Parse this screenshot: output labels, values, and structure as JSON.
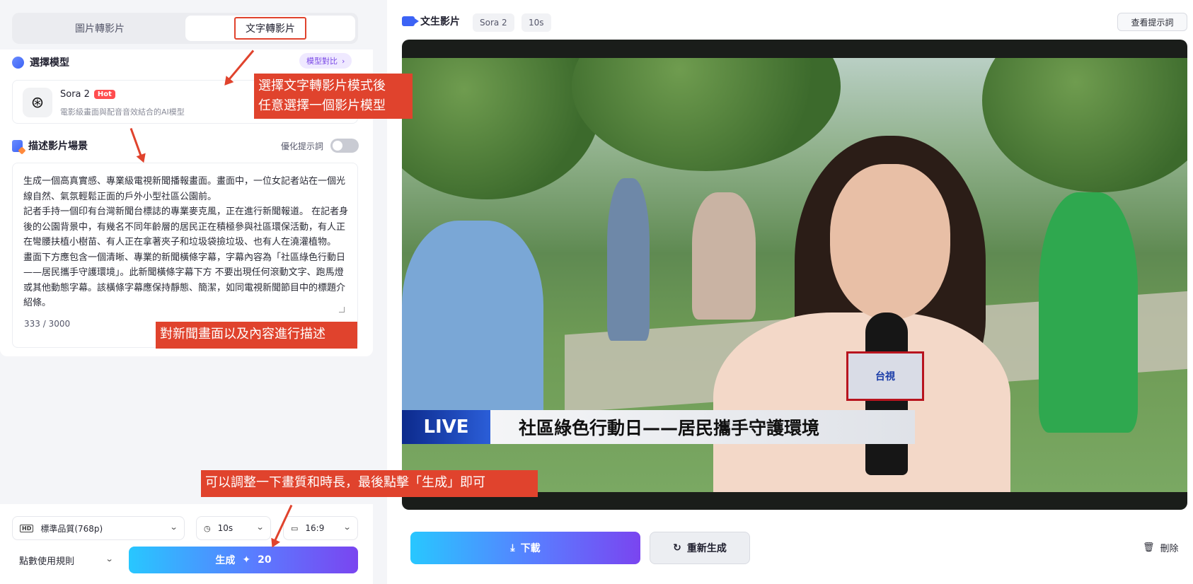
{
  "left_panel": {
    "mode_tabs": [
      "圖片轉影片",
      "文字轉影片"
    ],
    "model_section": {
      "title": "選擇模型",
      "compare_label": "模型對比",
      "model_name": "Sora 2",
      "hot_badge": "Hot",
      "model_desc": "電影級畫面與配音音效結合的AI模型"
    },
    "desc_section": {
      "title": "描述影片場景",
      "optimize_label": "優化提示詞",
      "prompt": "生成一個高真實感、專業級電視新聞播報畫面。畫面中，一位女記者站在一個光線自然、氣氛輕鬆正面的戶外小型社區公園前。\n記者手持一個印有台灣新聞台標誌的專業麥克風，正在進行新聞報道。 在記者身後的公園背景中，有幾名不同年齡層的居民正在積極參與社區環保活動，有人正在彎腰扶植小樹苗、有人正在拿著夾子和垃圾袋撿垃圾、也有人在澆灌植物。\n畫面下方應包含一個清晰、專業的新聞橫條字幕，字幕內容為「社區綠色行動日——居民攜手守護環境」。此新聞橫條字幕下方 不要出現任何滾動文字、跑馬燈或其他動態字幕。該橫條字幕應保持靜態、簡潔，如同電視新聞節目中的標題介紹條。",
      "char_count": "333 / 3000"
    },
    "settings": {
      "quality": "標準品質(768p)",
      "duration": "10s",
      "ratio": "16:9",
      "rules_label": "點數使用規則",
      "generate_label": "生成",
      "generate_cost": "20"
    }
  },
  "right_panel": {
    "title": "文生影片",
    "model_chip": "Sora 2",
    "duration_chip": "10s",
    "view_prompt_label": "查看提示詞",
    "video": {
      "live_label": "LIVE",
      "headline": "社區綠色行動日——居民攜手守護環境",
      "mic_logo": "台視"
    },
    "download_label": "下載",
    "regenerate_label": "重新生成",
    "delete_label": "刪除"
  },
  "annotations": {
    "note1": "選擇文字轉影片模式後\n任意選擇一個影片模型",
    "note2": "對新聞畫面以及內容進行描述",
    "note3": "可以調整一下畫質和時長，最後點擊「生成」即可"
  },
  "colors": {
    "accent_gradient_start": "#28c7ff",
    "accent_gradient_end": "#7a45f0",
    "annotation_red": "#e0432d",
    "hot_red": "#ff4d4f"
  }
}
